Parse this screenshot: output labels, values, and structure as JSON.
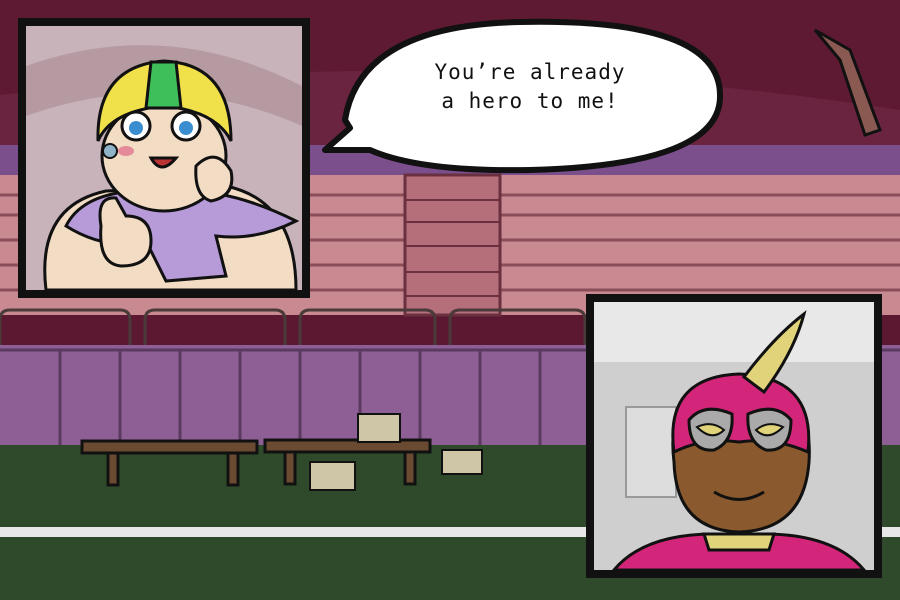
{
  "dialogue": {
    "line": "You’re already\na hero to me!"
  },
  "characters": {
    "left": "icon:fan-kid-portrait",
    "right": "icon:masked-hero-portrait"
  },
  "colors": {
    "stadium_wall": "#5b1830",
    "seats": "#c98990",
    "field": "#2e4a2b",
    "hero_mask": "#d3267a",
    "kid_helmet": "#f0e04a"
  }
}
